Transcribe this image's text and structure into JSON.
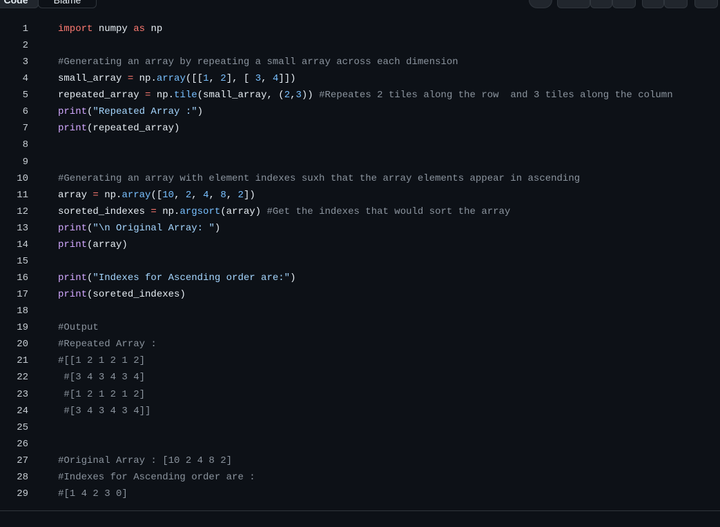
{
  "toolbar": {
    "code_tab": "Code",
    "blame_tab": "Blame"
  },
  "lines": [
    {
      "n": "1",
      "t": [
        [
          "kw",
          "import"
        ],
        [
          "",
          "numpy"
        ],
        [
          "kw",
          "as"
        ],
        [
          "",
          "np"
        ]
      ]
    }
  ],
  "code_lines": [
    "import numpy as np",
    "",
    "#Generating an array by repeating a small array across each dimension",
    "small_array = np.array([[1, 2], [ 3, 4]])",
    "repeated_array = np.tile(small_array, (2,3)) #Repeates 2 tiles along the row  and 3 tiles along the column",
    "print(\"Repeated Array :\")",
    "print(repeated_array)",
    "",
    "",
    "#Generating an array with element indexes suxh that the array elements appear in ascending",
    "array = np.array([10, 2, 4, 8, 2])",
    "soreted_indexes = np.argsort(array) #Get the indexes that would sort the array",
    "print(\"\\n Original Array: \")",
    "print(array)",
    "",
    "print(\"Indexes for Ascending order are:\")",
    "print(soreted_indexes)",
    "",
    "#Output",
    "#Repeated Array :",
    "#[[1 2 1 2 1 2]",
    " #[3 4 3 4 3 4]",
    " #[1 2 1 2 1 2]",
    " #[3 4 3 4 3 4]]",
    "",
    "",
    "#Original Array : [10 2 4 8 2]",
    "#Indexes for Ascending order are :",
    "#[1 4 2 3 0]"
  ]
}
